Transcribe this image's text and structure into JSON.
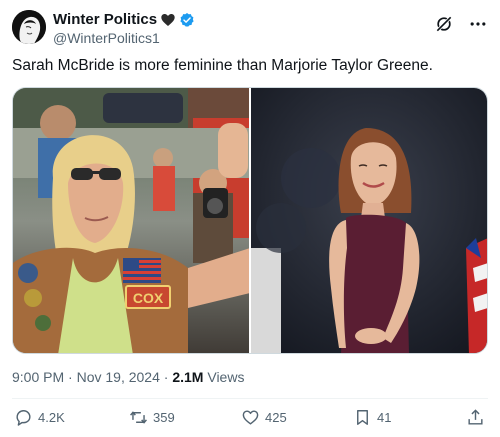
{
  "author": {
    "display_name": "Winter Politics",
    "handle": "@WinterPolitics1",
    "name_emoji": "black-heart-icon",
    "verified": true
  },
  "tweet": {
    "text": "Sarah McBride is more feminine than Marjorie Taylor Greene.",
    "time": "9:00 PM",
    "date": "Nov 19, 2024",
    "views_count": "2.1M",
    "views_label": "Views",
    "separator": "·"
  },
  "media": {
    "left_photo_patches": [
      "COX"
    ]
  },
  "actions": {
    "replies": "4.2K",
    "reposts": "359",
    "likes": "425",
    "bookmarks": "41"
  },
  "colors": {
    "verified": "#1d9bf0",
    "secondary_text": "#536471",
    "primary_text": "#0f1419"
  }
}
